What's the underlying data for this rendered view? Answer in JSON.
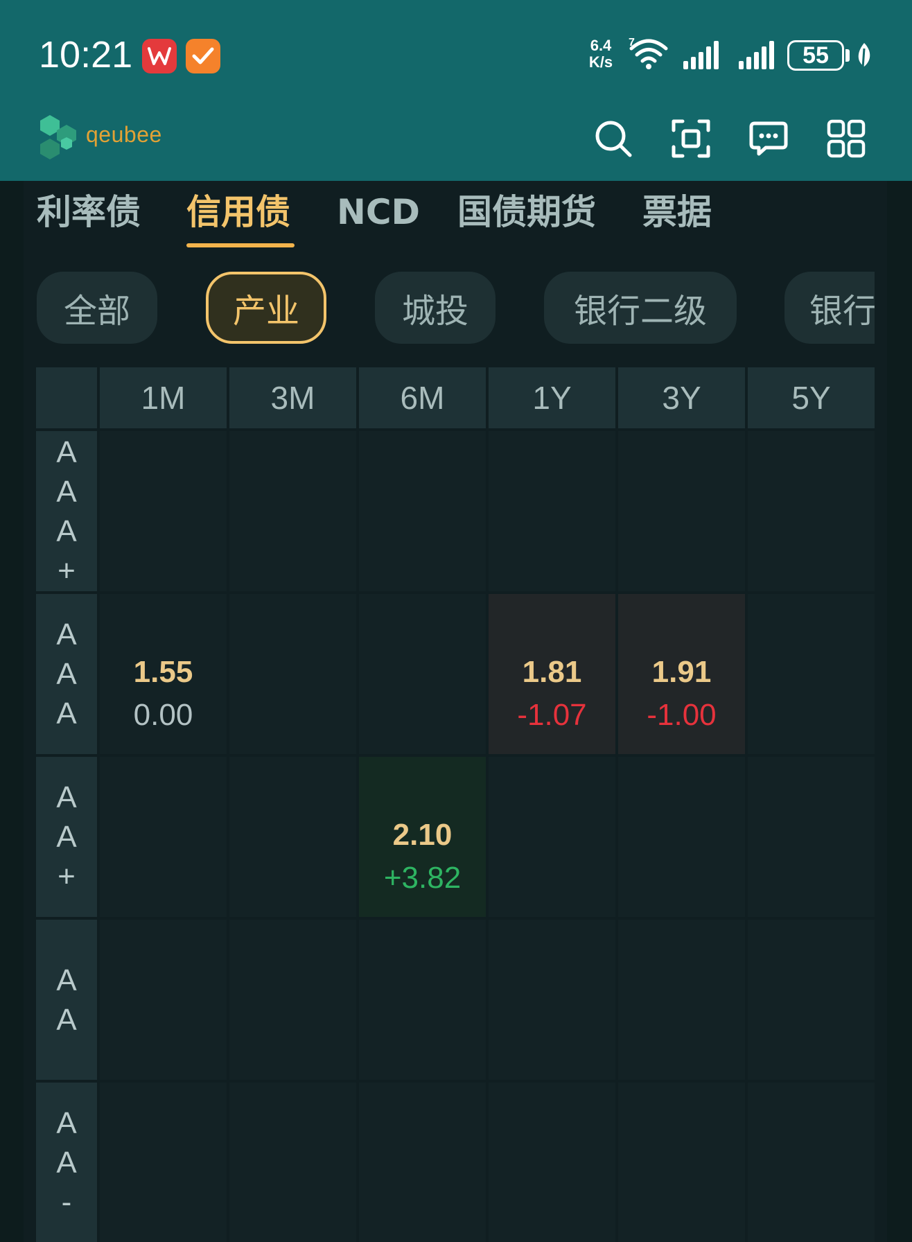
{
  "status_bar": {
    "time": "10:21",
    "net_speed_value": "6.4",
    "net_speed_unit": "K/s",
    "battery": "55",
    "icons": [
      "wps-office-icon",
      "task-check-icon",
      "wifi-icon",
      "signal-icon",
      "signal-icon",
      "battery-icon",
      "power-saving-leaf-icon"
    ]
  },
  "header": {
    "logo_text": "qeubee",
    "icons": [
      "search-icon",
      "scan-icon",
      "message-icon",
      "apps-grid-icon"
    ]
  },
  "main_tabs": [
    {
      "label": "利率债",
      "active": false
    },
    {
      "label": "信用债",
      "active": true
    },
    {
      "label": "NCD",
      "active": false
    },
    {
      "label": "国债期货",
      "active": false
    },
    {
      "label": "票据",
      "active": false
    }
  ],
  "filter_chips": [
    {
      "label": "全部",
      "active": false
    },
    {
      "label": "产业",
      "active": true
    },
    {
      "label": "城投",
      "active": false
    },
    {
      "label": "银行二级",
      "active": false
    },
    {
      "label": "银行",
      "active": false
    }
  ],
  "grid": {
    "columns": [
      "1M",
      "3M",
      "6M",
      "1Y",
      "3Y",
      "5Y"
    ],
    "rows": [
      {
        "rating": "AAA+",
        "letters": [
          "A",
          "A",
          "A",
          "+"
        ],
        "cells": [
          null,
          null,
          null,
          null,
          null,
          null
        ]
      },
      {
        "rating": "AAA",
        "letters": [
          "A",
          "A",
          "A"
        ],
        "cells": [
          {
            "value": "1.55",
            "change": "0.00",
            "dir": "flat"
          },
          null,
          null,
          {
            "value": "1.81",
            "change": "-1.07",
            "dir": "down"
          },
          {
            "value": "1.91",
            "change": "-1.00",
            "dir": "down"
          },
          null
        ]
      },
      {
        "rating": "AA+",
        "letters": [
          "A",
          "A",
          "+"
        ],
        "cells": [
          null,
          null,
          {
            "value": "2.10",
            "change": "+3.82",
            "dir": "up"
          },
          null,
          null,
          null
        ]
      },
      {
        "rating": "AA",
        "letters": [
          "A",
          "A"
        ],
        "cells": [
          null,
          null,
          null,
          null,
          null,
          null
        ]
      },
      {
        "rating": "AA-",
        "letters": [
          "A",
          "A",
          "-"
        ],
        "cells": [
          null,
          null,
          null,
          null,
          null,
          null
        ]
      }
    ]
  },
  "colors": {
    "header_bg": "#13686a",
    "accent": "#f3c46b",
    "price_up": "#2eb462",
    "price_down": "#e6323c"
  }
}
